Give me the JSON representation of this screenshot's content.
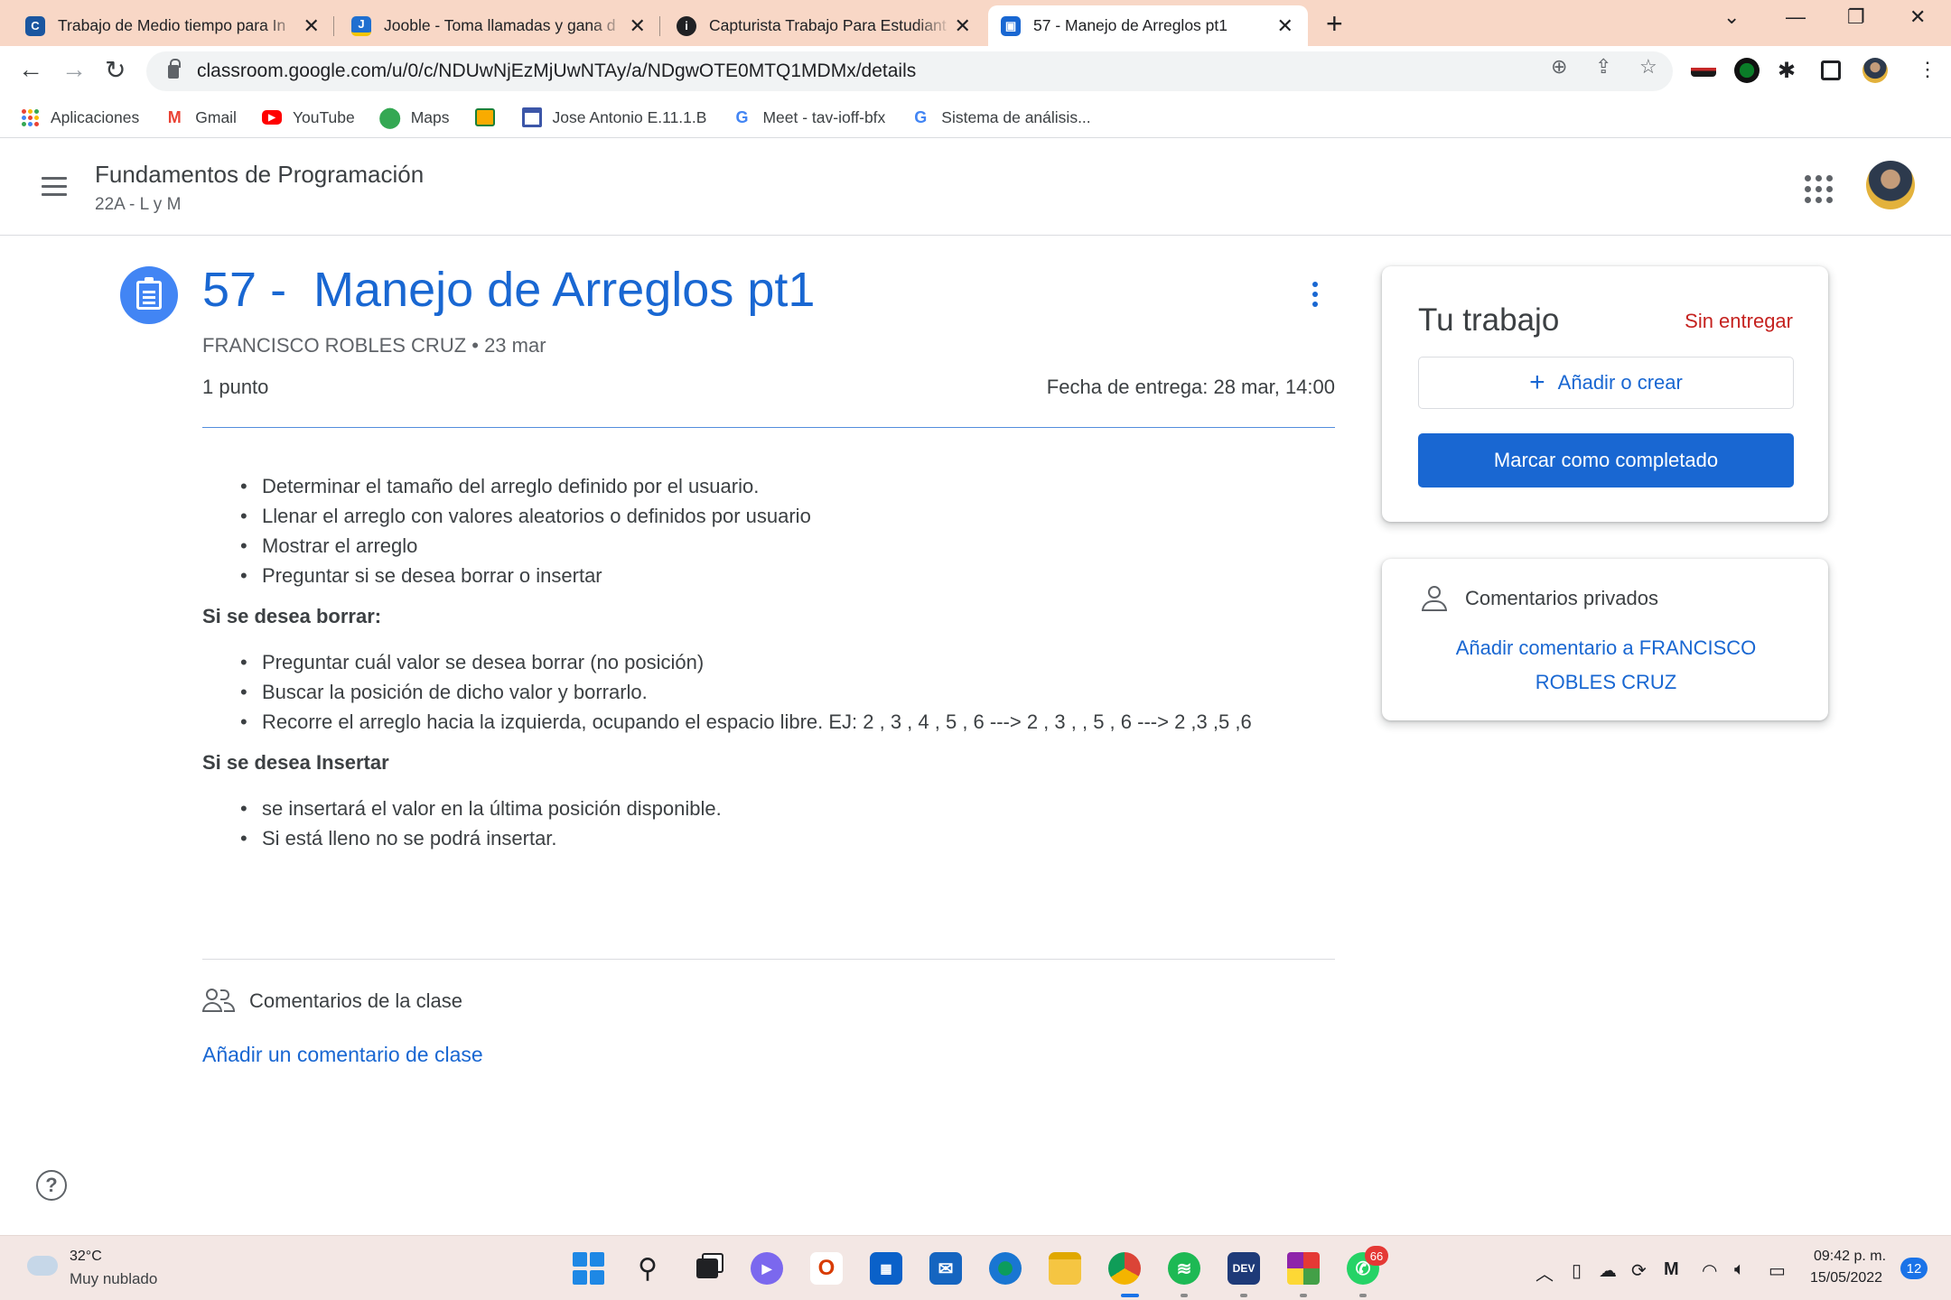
{
  "browser": {
    "tabs": [
      {
        "title": "Trabajo de Medio tiempo para In",
        "favicon": "computrabajo-icon",
        "color": "#1a56a0",
        "glyph": "C"
      },
      {
        "title": "Jooble - Toma llamadas y gana d",
        "favicon": "jooble-icon",
        "color": "#1f6fd0",
        "glyph": "J"
      },
      {
        "title": "Capturista Trabajo Para Estudiant",
        "favicon": "indeed-icon",
        "color": "#202124",
        "glyph": "i"
      },
      {
        "title": "57 - Manejo de Arreglos pt1",
        "favicon": "classroom-icon",
        "color": "#1967d2",
        "glyph": "C",
        "active": true
      }
    ],
    "url": "classroom.google.com/u/0/c/NDUwNjEzMjUwNTAy/a/NDgwOTE0MTQ1MDMx/details",
    "bookmarks": [
      {
        "label": "Aplicaciones",
        "icon": "apps-grid-icon"
      },
      {
        "label": "Gmail",
        "icon": "gmail-icon"
      },
      {
        "label": "YouTube",
        "icon": "youtube-icon"
      },
      {
        "label": "Maps",
        "icon": "maps-icon"
      },
      {
        "label": "",
        "icon": "classroom-bookmark-icon"
      },
      {
        "label": "Jose Antonio E.11.1.B",
        "icon": "calendar-icon"
      },
      {
        "label": "Meet - tav-ioff-bfx",
        "icon": "google-icon"
      },
      {
        "label": "Sistema de análisis...",
        "icon": "google-icon"
      }
    ]
  },
  "course": {
    "title": "Fundamentos de Programación",
    "section": "22A - L y M"
  },
  "assignment": {
    "title": "57 -  Manejo de Arreglos pt1",
    "author_date": "FRANCISCO ROBLES CRUZ • 23 mar",
    "points": "1 punto",
    "due": "Fecha de entrega: 28 mar, 14:00",
    "list1": [
      "Determinar el tamaño del arreglo  definido por el usuario.",
      "Llenar el arreglo con valores aleatorios o definidos por usuario",
      "Mostrar el arreglo",
      "Preguntar si se desea borrar o insertar"
    ],
    "heading_delete": "Si se desea borrar:",
    "list2": [
      "Preguntar cuál valor se desea borrar (no posición)",
      "Buscar la posición de dicho valor y borrarlo.",
      "Recorre el arreglo hacia la izquierda, ocupando el espacio libre. EJ:   2 , 3 , 4 , 5 , 6  --->   2 , 3 ,    , 5 , 6  --->   2 ,3 ,5 ,6"
    ],
    "heading_insert": "Si se desea Insertar",
    "list3": [
      "se insertará el valor en la última posición disponible.",
      "Si está lleno no se podrá insertar."
    ],
    "class_comments_label": "Comentarios de la clase",
    "add_class_comment": "Añadir un comentario de clase"
  },
  "your_work": {
    "title": "Tu trabajo",
    "status": "Sin entregar",
    "add_create": "Añadir o crear",
    "mark_done": "Marcar como completado"
  },
  "private_comments": {
    "title": "Comentarios privados",
    "add": "Añadir comentario a FRANCISCO ROBLES CRUZ"
  },
  "taskbar": {
    "temperature": "32°C",
    "weather": "Muy nublado",
    "whatsapp_badge": "66",
    "time": "09:42 p. m.",
    "date": "15/05/2022",
    "notifications": "12"
  },
  "colors": {
    "accent": "#1967d2",
    "status_red": "#c5221f",
    "tabbar": "#f8d7c6"
  }
}
